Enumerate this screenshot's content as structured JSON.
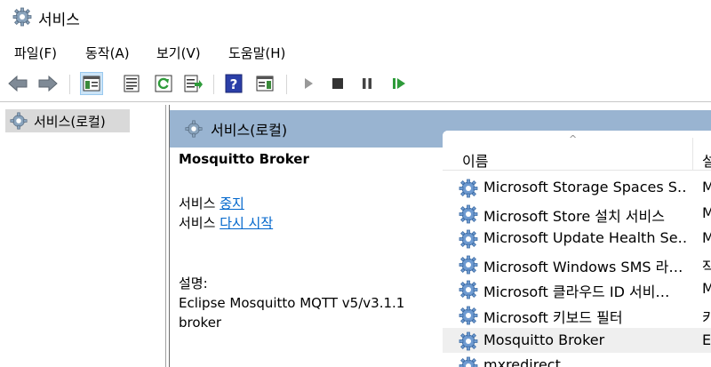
{
  "window": {
    "title": "서비스"
  },
  "menu": [
    "파일(F)",
    "동작(A)",
    "보기(V)",
    "도움말(H)"
  ],
  "tree": {
    "root_label": "서비스(로컬)"
  },
  "content_header": {
    "label": "서비스(로컬)"
  },
  "detail": {
    "service_name": "Mosquitto Broker",
    "stop_prefix": "서비스",
    "stop_link": "중지",
    "restart_prefix": "서비스",
    "restart_link": "다시 시작",
    "description_label": "설명:",
    "description_text": "Eclipse Mosquitto MQTT v5/v3.1.1 broker"
  },
  "list": {
    "header_name": "이름",
    "header_desc": "설",
    "rows": [
      {
        "name": "Microsoft Storage Spaces S…",
        "desc": "M"
      },
      {
        "name": "Microsoft Store 설치 서비스",
        "desc": "M"
      },
      {
        "name": "Microsoft Update Health Se…",
        "desc": "M"
      },
      {
        "name": "Microsoft Windows SMS 라…",
        "desc": "작"
      },
      {
        "name": "Microsoft 클라우드 ID 서비…",
        "desc": "M"
      },
      {
        "name": "Microsoft 키보드 필터",
        "desc": "키"
      },
      {
        "name": "Mosquitto Broker",
        "desc": "E"
      },
      {
        "name": "mxredirect",
        "desc": ""
      }
    ],
    "selected_index": 6
  },
  "icons": {
    "app": "gear-services-icon",
    "back": "back-arrow-icon",
    "forward": "forward-arrow-icon",
    "show_tree": "show-console-tree-icon",
    "properties": "properties-icon",
    "refresh": "refresh-icon",
    "export": "export-list-icon",
    "help": "help-icon",
    "show_action_pane": "action-pane-icon",
    "start": "start-service-icon",
    "stop": "stop-service-icon",
    "pause": "pause-service-icon",
    "resume": "resume-service-icon"
  },
  "colors": {
    "content_header_bg": "#99b4d1",
    "link": "#0066cc",
    "selected_row": "#efefef",
    "tree_selected": "#d9d9d9"
  }
}
